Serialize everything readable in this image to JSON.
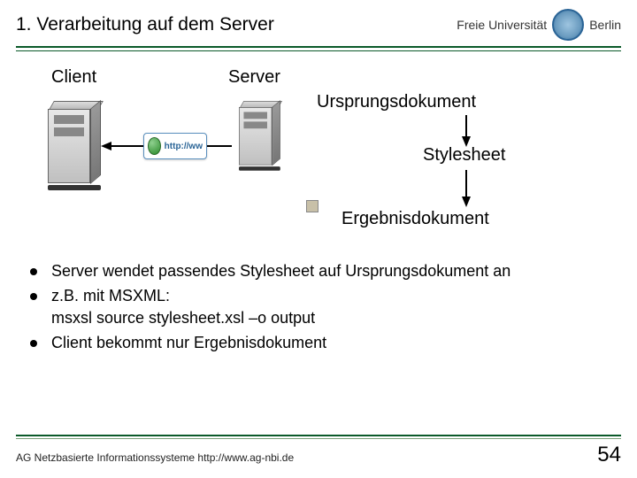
{
  "header": {
    "title": "1. Verarbeitung auf dem Server",
    "logo_text": "Freie Universität",
    "logo_city": "Berlin"
  },
  "diagram": {
    "client_label": "Client",
    "server_label": "Server",
    "ursprung": "Ursprungsdokument",
    "stylesheet": "Stylesheet",
    "ergebnis": "Ergebnisdokument",
    "http_label": "http://ww"
  },
  "bullets": [
    "Server wendet passendes Stylesheet auf Ursprungsdokument an",
    "z.B. mit MSXML:\nmsxsl source stylesheet.xsl –o output",
    "Client bekommt nur Ergebnisdokument"
  ],
  "footer": {
    "text": "AG Netzbasierte Informationssysteme http://www.ag-nbi.de",
    "page": "54"
  }
}
